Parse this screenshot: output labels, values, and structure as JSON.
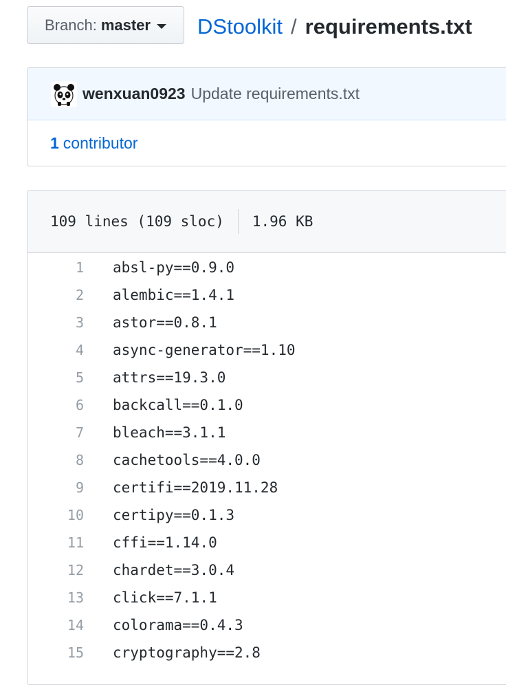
{
  "branch": {
    "prefix": "Branch:",
    "name": "master"
  },
  "breadcrumb": {
    "repo": "DStoolkit",
    "separator": "/",
    "file": "requirements.txt"
  },
  "commit": {
    "author": "wenxuan0923",
    "message": "Update requirements.txt",
    "avatar_icon": "panda-avatar"
  },
  "contributors": {
    "count": "1",
    "label": "contributor"
  },
  "file_info": {
    "lines": "109 lines (109 sloc)",
    "size": "1.96 KB"
  },
  "code_lines": [
    {
      "num": "1",
      "text": "absl-py==0.9.0"
    },
    {
      "num": "2",
      "text": "alembic==1.4.1"
    },
    {
      "num": "3",
      "text": "astor==0.8.1"
    },
    {
      "num": "4",
      "text": "async-generator==1.10"
    },
    {
      "num": "5",
      "text": "attrs==19.3.0"
    },
    {
      "num": "6",
      "text": "backcall==0.1.0"
    },
    {
      "num": "7",
      "text": "bleach==3.1.1"
    },
    {
      "num": "8",
      "text": "cachetools==4.0.0"
    },
    {
      "num": "9",
      "text": "certifi==2019.11.28"
    },
    {
      "num": "10",
      "text": "certipy==0.1.3"
    },
    {
      "num": "11",
      "text": "cffi==1.14.0"
    },
    {
      "num": "12",
      "text": "chardet==3.0.4"
    },
    {
      "num": "13",
      "text": "click==7.1.1"
    },
    {
      "num": "14",
      "text": "colorama==0.4.3"
    },
    {
      "num": "15",
      "text": "cryptography==2.8"
    }
  ],
  "colors": {
    "link": "#0366d6",
    "text": "#24292e",
    "muted": "#586069",
    "line_number": "#959da5"
  }
}
